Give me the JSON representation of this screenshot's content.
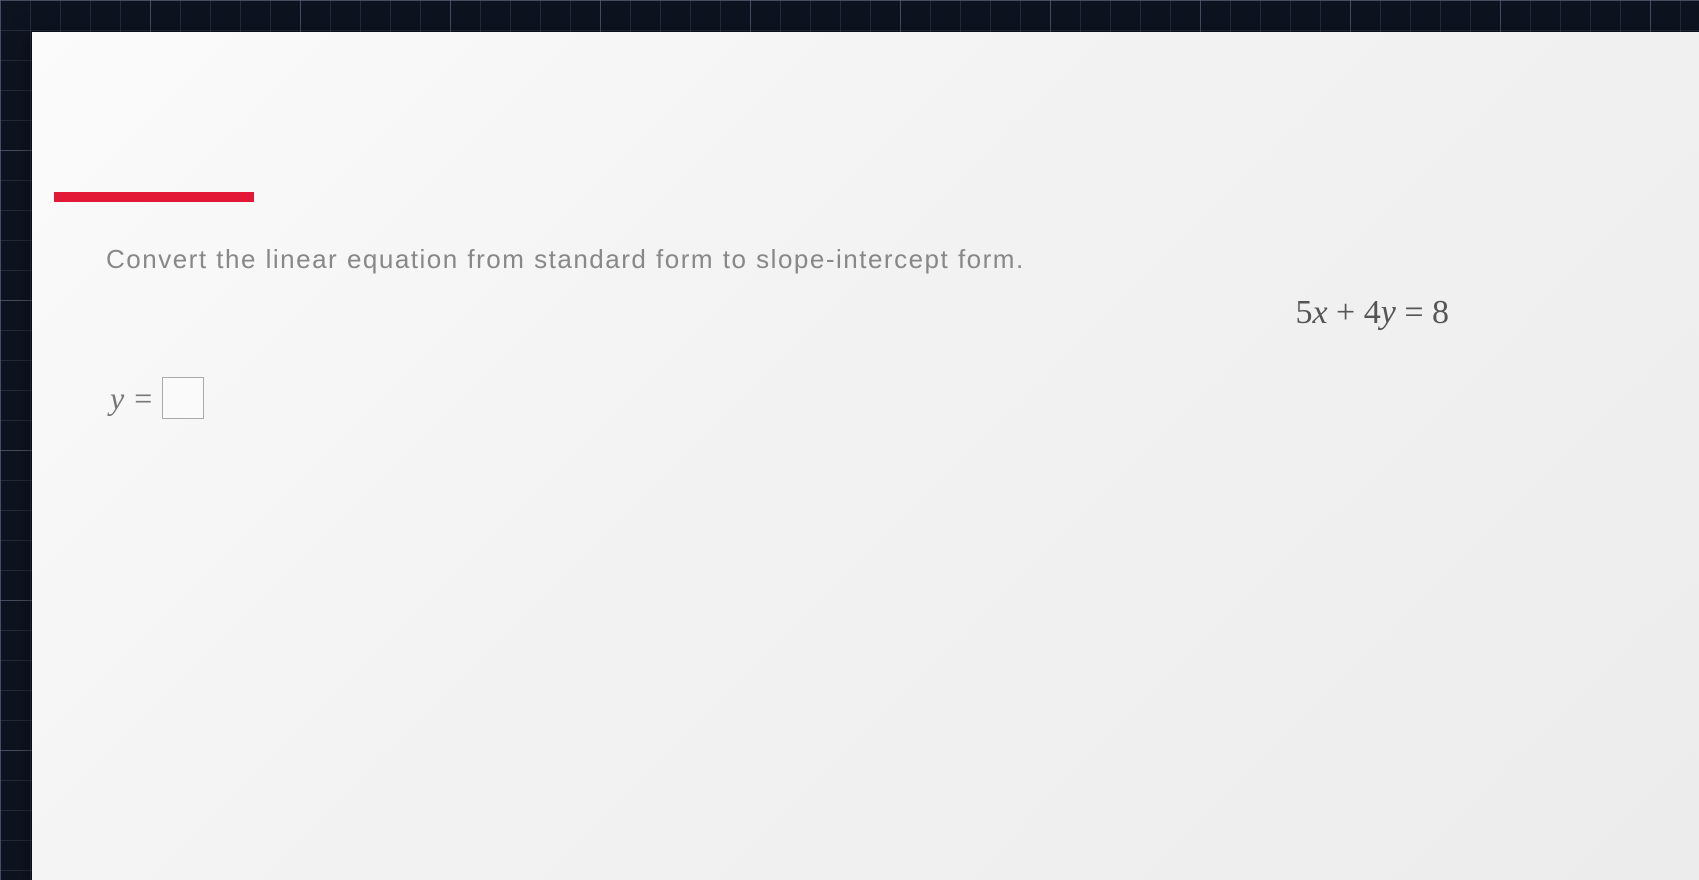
{
  "prompt": "Convert the linear equation from standard form to slope-intercept form.",
  "equation": {
    "coeff1": "5",
    "var1": "x",
    "op": "+",
    "coeff2": "4",
    "var2": "y",
    "eq": "=",
    "rhs": "8"
  },
  "answer": {
    "lhs_var": "y",
    "eq": "=",
    "value": ""
  }
}
